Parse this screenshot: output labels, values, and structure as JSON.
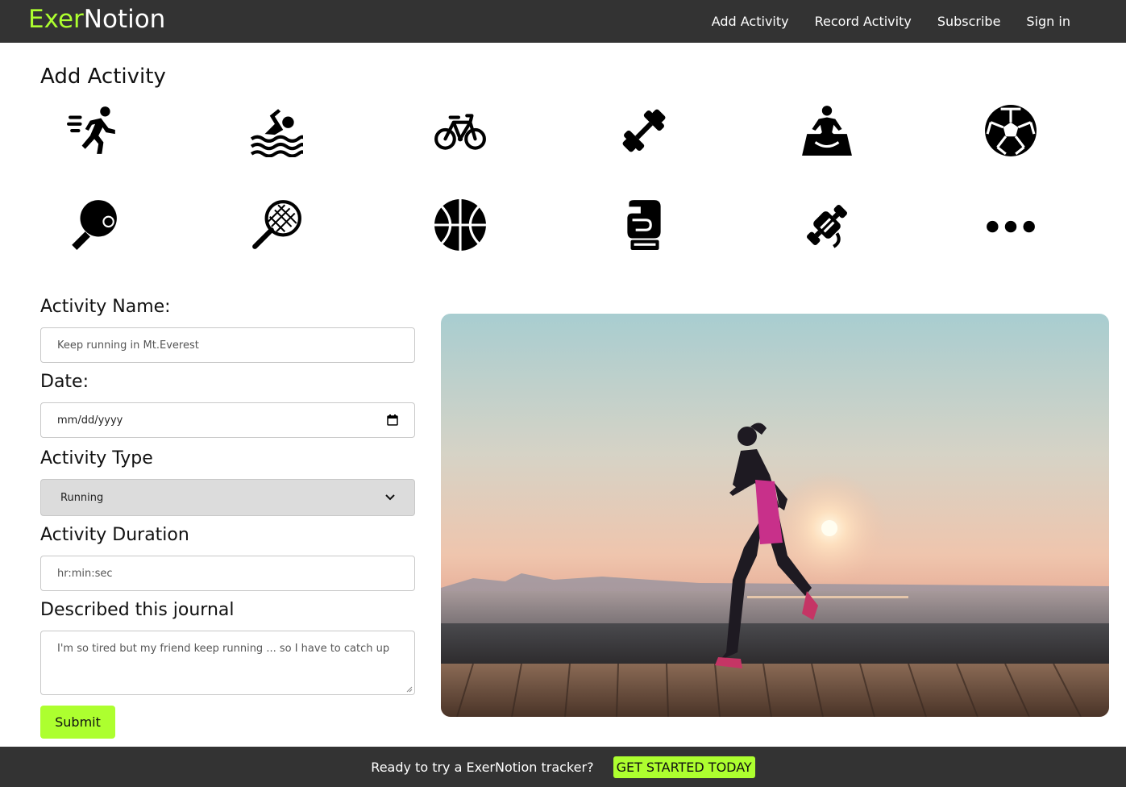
{
  "brand": {
    "part1": "Exer",
    "part2": "Notion",
    "accent_color": "#adff2f"
  },
  "nav": {
    "items": [
      {
        "label": "Add Activity"
      },
      {
        "label": "Record Activity"
      },
      {
        "label": "Subscribe"
      },
      {
        "label": "Sign in"
      }
    ]
  },
  "main": {
    "title": "Add Activity",
    "activity_icons": [
      "running-icon",
      "swimming-icon",
      "cycling-icon",
      "dumbbell-icon",
      "meditation-icon",
      "soccer-ball-icon",
      "table-tennis-icon",
      "tennis-racket-icon",
      "basketball-icon",
      "boxing-glove-icon",
      "weightlifting-icon",
      "more-options-icon"
    ]
  },
  "form": {
    "name_label": "Activity Name:",
    "name_placeholder": "Keep running in Mt.Everest",
    "date_label": "Date:",
    "date_placeholder": "mm/dd/yyyy",
    "type_label": "Activity Type",
    "type_selected": "Running",
    "duration_label": "Activity Duration",
    "duration_placeholder": "hr:min:sec",
    "journal_label": "Described this journal",
    "journal_placeholder": "I'm so tired but my friend keep running ... so I have to catch up",
    "submit_label": "Submit"
  },
  "footer": {
    "text": "Ready to try a ExerNotion tracker?",
    "cta_label": "GET STARTED TODAY"
  }
}
